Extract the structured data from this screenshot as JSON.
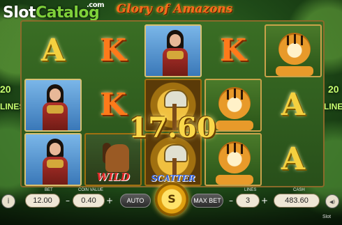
{
  "watermark": {
    "brand_part1": "Slot",
    "brand_part2": "Catalog",
    "brand_dot": ".com"
  },
  "game": {
    "title": "Glory of Amazons"
  },
  "win": {
    "amount": "17.60"
  },
  "side_text": {
    "left_lines": "20",
    "left_label": "LINES",
    "right_lines": "20",
    "right_label": "LINES"
  },
  "grid": {
    "reels": [
      [
        "A",
        "amazon",
        "amazon"
      ],
      [
        "K",
        "K",
        "wild"
      ],
      [
        "amazon",
        "axe",
        "scatter"
      ],
      [
        "K",
        "tiger",
        "tiger"
      ],
      [
        "tiger",
        "A",
        "A"
      ]
    ],
    "symbol_labels": {
      "A": "A",
      "K": "K",
      "wild": "WILD",
      "scatter": "SCATTER"
    }
  },
  "controls": {
    "bet_label": "BET",
    "bet_value": "12.00",
    "coin_label": "COIN VALUE",
    "coin_value": "0.40",
    "minus": "–",
    "plus": "+",
    "auto_label": "AUTO",
    "spin_label": "S",
    "maxbet_label": "MAX BET",
    "lines_label": "LINES",
    "lines_value": "3",
    "cash_label": "CASH",
    "cash_value": "483.60",
    "info_icon": "i",
    "sound_icon": "◀)"
  },
  "footer_brand": "Slot"
}
